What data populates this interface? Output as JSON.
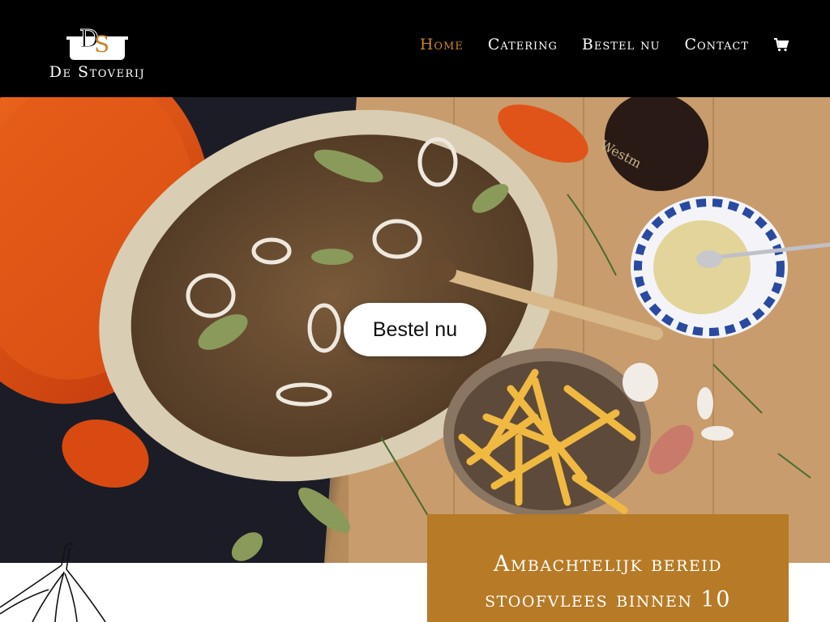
{
  "brand": {
    "name": "De Stoverij",
    "monogram": "DS",
    "accent": "#c8862b"
  },
  "nav": {
    "items": [
      {
        "label": "Home",
        "active": true
      },
      {
        "label": "Catering",
        "active": false
      },
      {
        "label": "Bestel nu",
        "active": false
      },
      {
        "label": "Contact",
        "active": false
      }
    ],
    "cart_icon": "shopping-cart-icon"
  },
  "hero": {
    "cta_label": "Bestel nu"
  },
  "promo": {
    "line1": "Ambachtelijk bereid",
    "line2": "stoofvlees binnen 10",
    "color": "#b77a26"
  }
}
